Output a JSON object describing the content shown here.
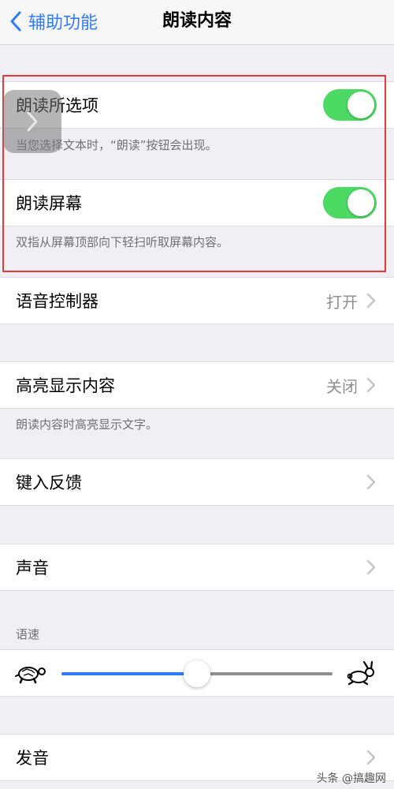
{
  "nav": {
    "back_label": "辅助功能",
    "title": "朗读内容"
  },
  "speak_selection": {
    "label": "朗读所选项",
    "on": true,
    "footer": "当您选择文本时，“朗读”按钮会出现。"
  },
  "speak_screen": {
    "label": "朗读屏幕",
    "on": true,
    "footer": "双指从屏幕顶部向下轻扫听取屏幕内容。"
  },
  "speech_controller": {
    "label": "语音控制器",
    "value": "打开"
  },
  "highlight_content": {
    "label": "高亮显示内容",
    "value": "关闭",
    "footer": "朗读内容时高亮显示文字。"
  },
  "typing_feedback": {
    "label": "键入反馈"
  },
  "voices": {
    "label": "声音"
  },
  "speaking_rate": {
    "header": "语速",
    "level": 0.5
  },
  "pronunciations": {
    "label": "发音"
  },
  "watermark": "头条 @搞趣网",
  "colors": {
    "accent": "#2f7bf6",
    "toggle_on": "#4cd964",
    "highlight_border": "#e53a3a"
  }
}
